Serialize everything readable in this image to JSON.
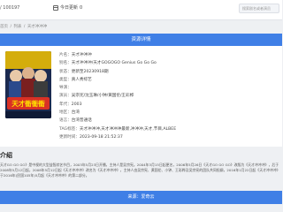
{
  "topbar": {
    "count": "/ 100197",
    "today_label": "今日更新",
    "today_count": "0",
    "search_placeholder": "搜索剧名或者演员"
  },
  "breadcrumb": {
    "items": [
      "首页",
      "列表",
      "天才冲冲冲"
    ],
    "separator": "/"
  },
  "details": {
    "header": "资源详情",
    "rows": [
      {
        "key": "片名：",
        "value": "天才冲冲冲"
      },
      {
        "key": "别名：",
        "value": "天才冲冲冲/天才GOGOGO Genius Go Go Go"
      },
      {
        "key": "状态：",
        "value": "更新至20230918期"
      },
      {
        "key": "类型：",
        "value": "真人秀综艺"
      },
      {
        "key": "导演：",
        "value": ""
      },
      {
        "key": "演员：",
        "value": "吴宗宪/沈玉琳/小钟/黄国伦/王彩桦"
      },
      {
        "key": "年代：",
        "value": "2003"
      },
      {
        "key": "地区：",
        "value": "台湾"
      },
      {
        "key": "语言：",
        "value": "台湾普通话"
      },
      {
        "key": "TAG标签：",
        "value": "天才冲冲冲,天才冲冲冲最新,冲冲冲,天才,节目,ALBEE"
      },
      {
        "key": "更新时间：",
        "value": "2023-09-18 21:52:37"
      }
    ]
  },
  "synopsis": {
    "title": "介绍",
    "text": "天才GO GO GO》是中视的大型益智综艺节目，2003年5月23日开播，主持人是吴宗宪。2004年3月15日起更名，2006年5月26日《天才GO GO GO》改版为《天才冲冲冲》，后于2008年5月12日起，2008年5月12日起《天才冲冲冲》改名为《天才冲冲冲》，主持人由吴宗宪、黄国伦、小钟、王彩桦及吴宗宪的团队共同担纲，2016年1月22日起《天才冲冲冲》于2016年(民国105年)5月起《天才冲冲冲》的第二部分。"
  },
  "source": {
    "label": "来源：爱奇云"
  },
  "poster": {
    "title_art": "天才衝衝衝",
    "colors": {
      "bg": "#1b2a50",
      "accent": "#f5c400",
      "banner": "#d93025"
    }
  },
  "colors": {
    "primary": "#3f7fe6"
  }
}
